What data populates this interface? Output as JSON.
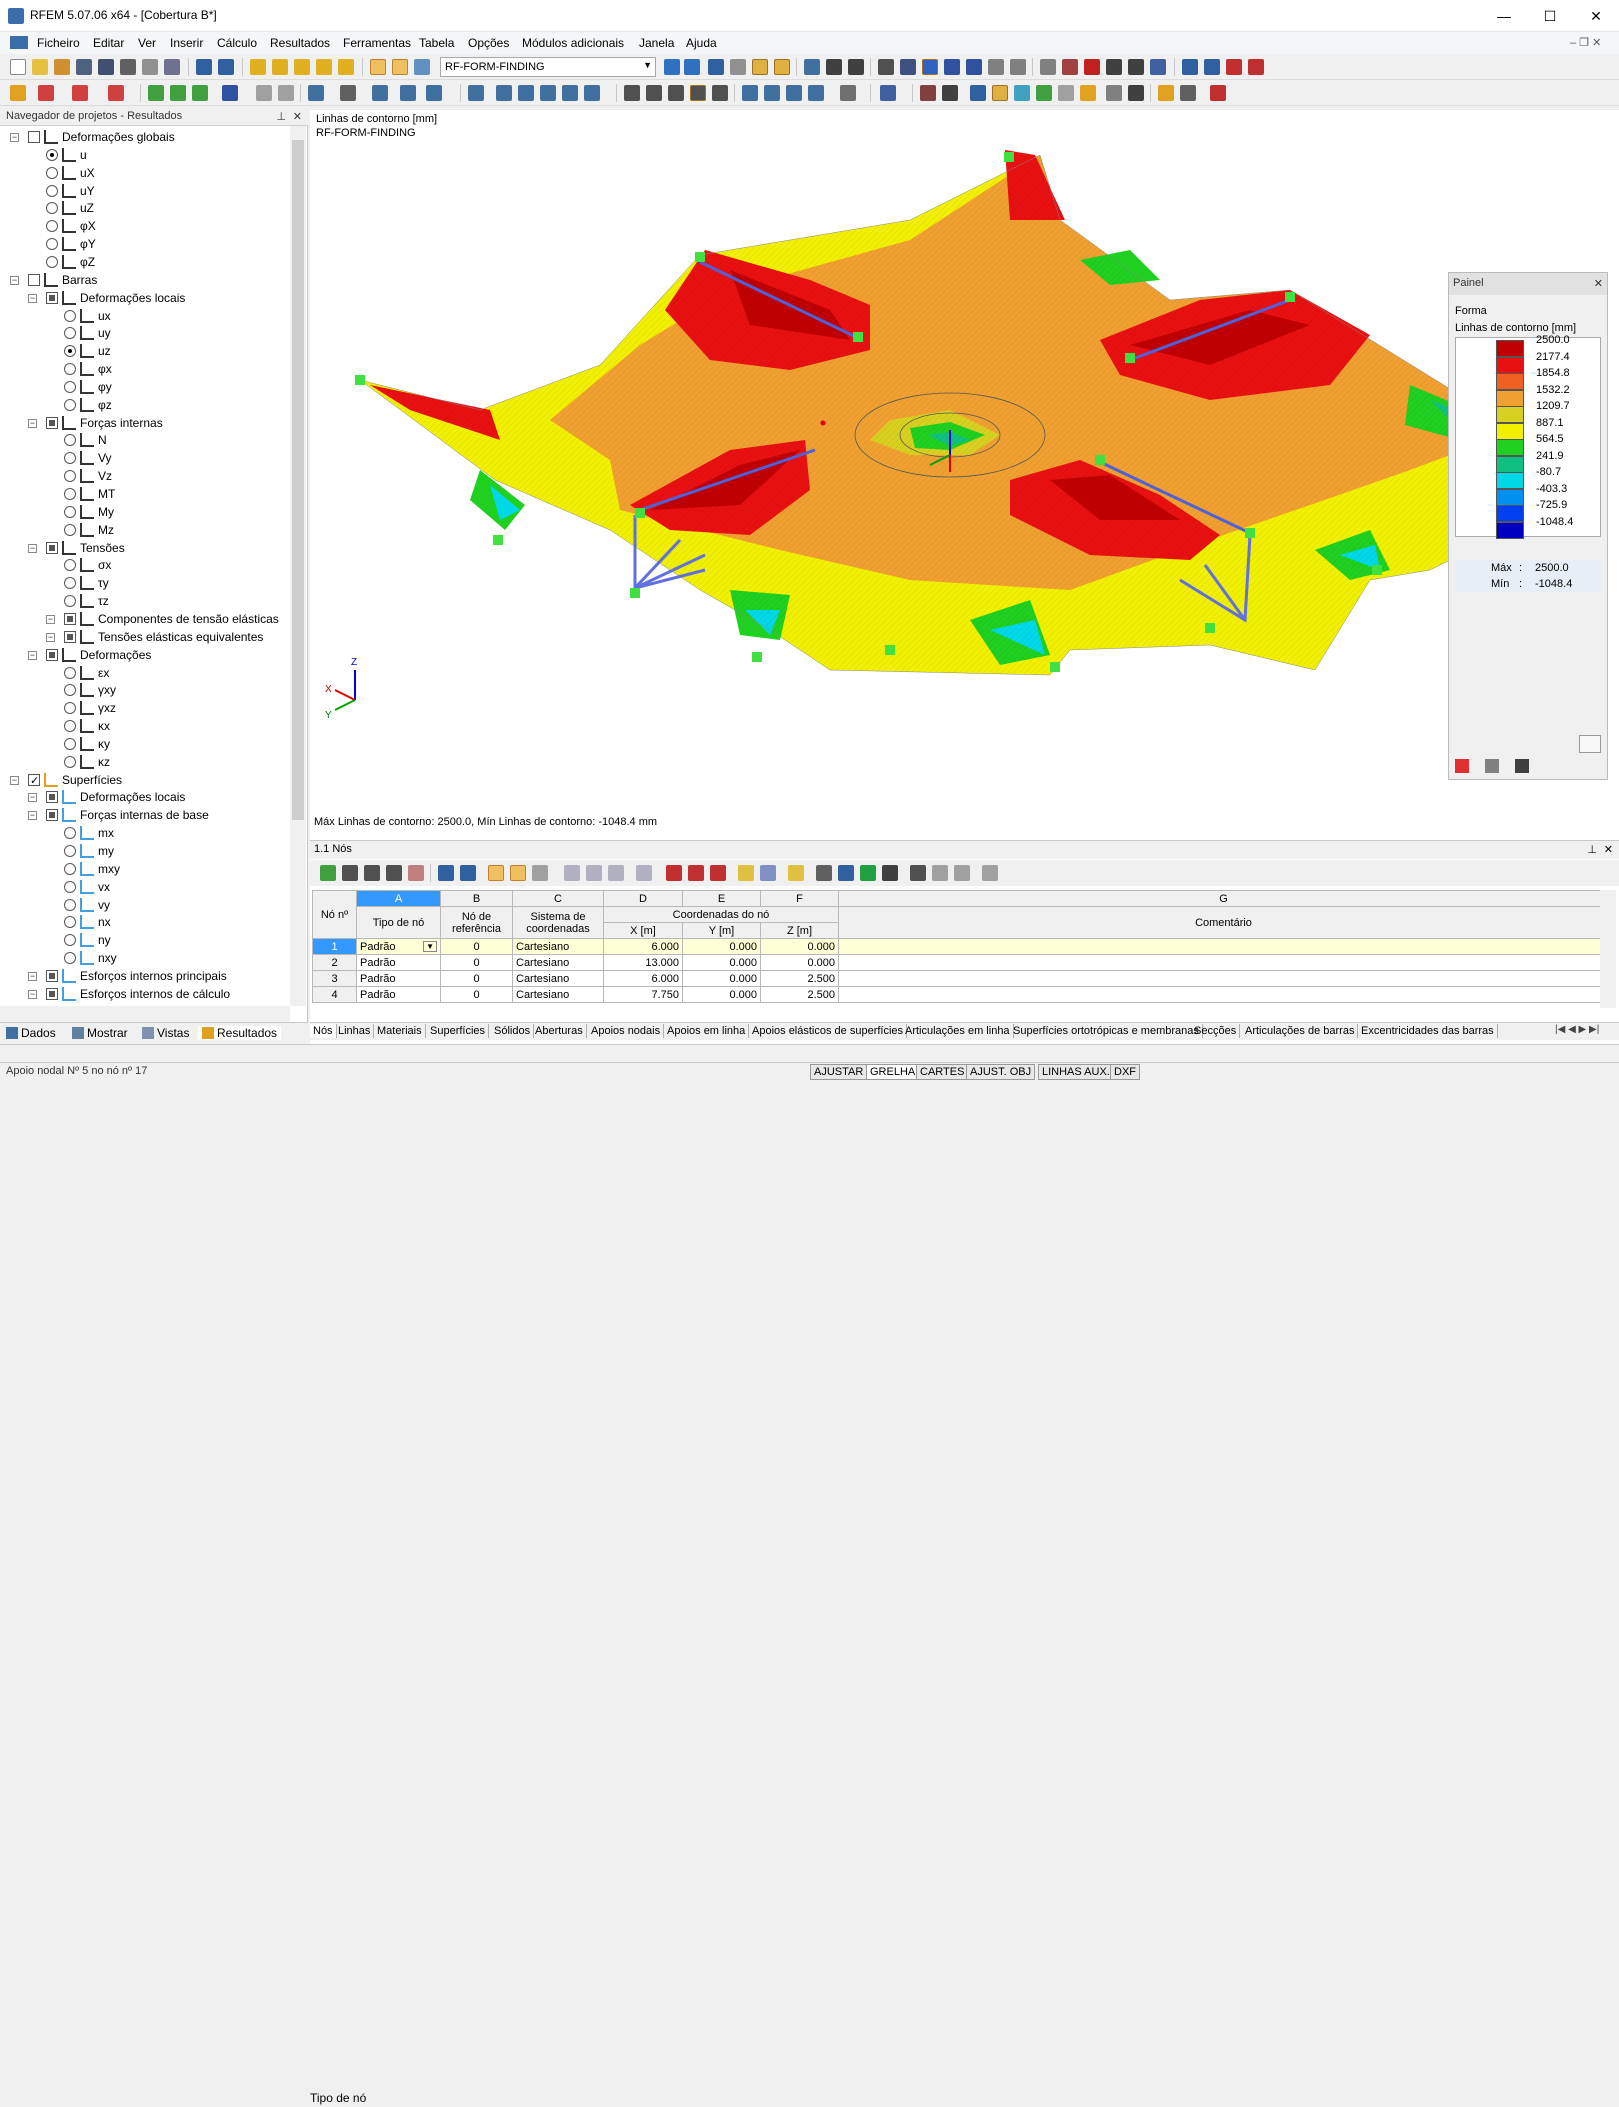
{
  "window": {
    "title": "RFEM 5.07.06 x64 - [Cobertura B*]",
    "minimize": "—",
    "maximize": "☐",
    "close": "✕"
  },
  "menu": [
    "Ficheiro",
    "Editar",
    "Ver",
    "Inserir",
    "Cálculo",
    "Resultados",
    "Ferramentas",
    "Tabela",
    "Opções",
    "Módulos adicionais",
    "Janela",
    "Ajuda"
  ],
  "toolbar": {
    "combo_value": "RF-FORM-FINDING"
  },
  "navigator": {
    "title": "Navegador de projetos - Resultados",
    "items": [
      {
        "label": "Deformações globais",
        "level": 0
      },
      {
        "label": "u",
        "level": 1
      },
      {
        "label": "uX",
        "level": 1
      },
      {
        "label": "uY",
        "level": 1
      },
      {
        "label": "uZ",
        "level": 1
      },
      {
        "label": "φX",
        "level": 1
      },
      {
        "label": "φY",
        "level": 1
      },
      {
        "label": "φZ",
        "level": 1
      },
      {
        "label": "Barras",
        "level": 0
      },
      {
        "label": "Deformações locais",
        "level": 1
      },
      {
        "label": "ux",
        "level": 2
      },
      {
        "label": "uy",
        "level": 2
      },
      {
        "label": "uz",
        "level": 2
      },
      {
        "label": "φx",
        "level": 2
      },
      {
        "label": "φy",
        "level": 2
      },
      {
        "label": "φz",
        "level": 2
      },
      {
        "label": "Forças internas",
        "level": 1
      },
      {
        "label": "N",
        "level": 2
      },
      {
        "label": "Vy",
        "level": 2
      },
      {
        "label": "Vz",
        "level": 2
      },
      {
        "label": "MT",
        "level": 2
      },
      {
        "label": "My",
        "level": 2
      },
      {
        "label": "Mz",
        "level": 2
      },
      {
        "label": "Tensões",
        "level": 1
      },
      {
        "label": "σx",
        "level": 2
      },
      {
        "label": "τy",
        "level": 2
      },
      {
        "label": "τz",
        "level": 2
      },
      {
        "label": "Componentes de tensão elásticas",
        "level": 2
      },
      {
        "label": "Tensões elásticas equivalentes",
        "level": 2
      },
      {
        "label": "Deformações",
        "level": 1
      },
      {
        "label": "εx",
        "level": 2
      },
      {
        "label": "γxy",
        "level": 2
      },
      {
        "label": "γxz",
        "level": 2
      },
      {
        "label": "κx",
        "level": 2
      },
      {
        "label": "κy",
        "level": 2
      },
      {
        "label": "κz",
        "level": 2
      },
      {
        "label": "Superfícies",
        "level": 0
      },
      {
        "label": "Deformações locais",
        "level": 1
      },
      {
        "label": "Forças internas de base",
        "level": 1
      },
      {
        "label": "mx",
        "level": 2
      },
      {
        "label": "my",
        "level": 2
      },
      {
        "label": "mxy",
        "level": 2
      },
      {
        "label": "vx",
        "level": 2
      },
      {
        "label": "vy",
        "level": 2
      },
      {
        "label": "nx",
        "level": 2
      },
      {
        "label": "ny",
        "level": 2
      },
      {
        "label": "nxy",
        "level": 2
      },
      {
        "label": "Esforços internos principais",
        "level": 1
      },
      {
        "label": "Esforços internos de cálculo",
        "level": 1
      }
    ],
    "tabs": [
      "Dados",
      "Mostrar",
      "Vistas",
      "Resultados"
    ]
  },
  "view": {
    "label1": "Linhas de contorno [mm]",
    "label2": "RF-FORM-FINDING",
    "maxmin": "Máx Linhas de contorno: 2500.0, Mín Linhas de contorno: -1048.4 mm",
    "axes": {
      "x": "X",
      "y": "Y",
      "z": "Z"
    }
  },
  "panel": {
    "title": "Painel",
    "line1": "Forma",
    "line2": "Linhas de contorno [mm]",
    "legend": [
      {
        "value": "2500.0",
        "color": "#c00000"
      },
      {
        "value": "2177.4",
        "color": "#e81010"
      },
      {
        "value": "1854.8",
        "color": "#f06020"
      },
      {
        "value": "1532.2",
        "color": "#f0a030"
      },
      {
        "value": "1209.7",
        "color": "#d8d020"
      },
      {
        "value": "887.1",
        "color": "#f0f000"
      },
      {
        "value": "564.5",
        "color": "#20d020"
      },
      {
        "value": "241.9",
        "color": "#10c080"
      },
      {
        "value": "-80.7",
        "color": "#00d8e8"
      },
      {
        "value": "-403.3",
        "color": "#0090f0"
      },
      {
        "value": "-725.9",
        "color": "#0040f0"
      },
      {
        "value": "-1048.4",
        "color": "#0000c0"
      }
    ],
    "max_label": "Máx",
    "max_value": "2500.0",
    "min_label": "Mín",
    "min_value": "-1048.4"
  },
  "table": {
    "title": "1.1 Nós",
    "col_letters": [
      "A",
      "B",
      "C",
      "D",
      "E",
      "F",
      "G"
    ],
    "h_no": "Nó nº",
    "h_tipo": "Tipo de nó",
    "h_ref": "Nó de referência",
    "h_sis": "Sistema de coordenadas",
    "h_coord": "Coordenadas do nó",
    "h_x": "X [m]",
    "h_y": "Y [m]",
    "h_z": "Z [m]",
    "h_com": "Comentário",
    "rows": [
      {
        "no": "1",
        "tipo": "Padrão",
        "ref": "0",
        "sis": "Cartesiano",
        "x": "6.000",
        "y": "0.000",
        "z": "0.000"
      },
      {
        "no": "2",
        "tipo": "Padrão",
        "ref": "0",
        "sis": "Cartesiano",
        "x": "13.000",
        "y": "0.000",
        "z": "0.000"
      },
      {
        "no": "3",
        "tipo": "Padrão",
        "ref": "0",
        "sis": "Cartesiano",
        "x": "6.000",
        "y": "0.000",
        "z": "2.500"
      },
      {
        "no": "4",
        "tipo": "Padrão",
        "ref": "0",
        "sis": "Cartesiano",
        "x": "7.750",
        "y": "0.000",
        "z": "2.500"
      }
    ]
  },
  "sheet_tabs": [
    "Nós",
    "Linhas",
    "Materiais",
    "Superfícies",
    "Sólidos",
    "Aberturas",
    "Apoios nodais",
    "Apoios em linha",
    "Apoios elásticos de superfícies",
    "Articulações em linha",
    "Superfícies ortotrópicas e membranas",
    "Secções",
    "Articulações de barras",
    "Excentricidades das barras"
  ],
  "column_field": "Tipo de nó",
  "status": {
    "left": "Apoio nodal Nº 5 no nó nº 17",
    "buttons": [
      "AJUSTAR",
      "GRELHA",
      "CARTES",
      "AJUST. OBJ",
      "LINHAS AUX.",
      "DXF"
    ]
  }
}
